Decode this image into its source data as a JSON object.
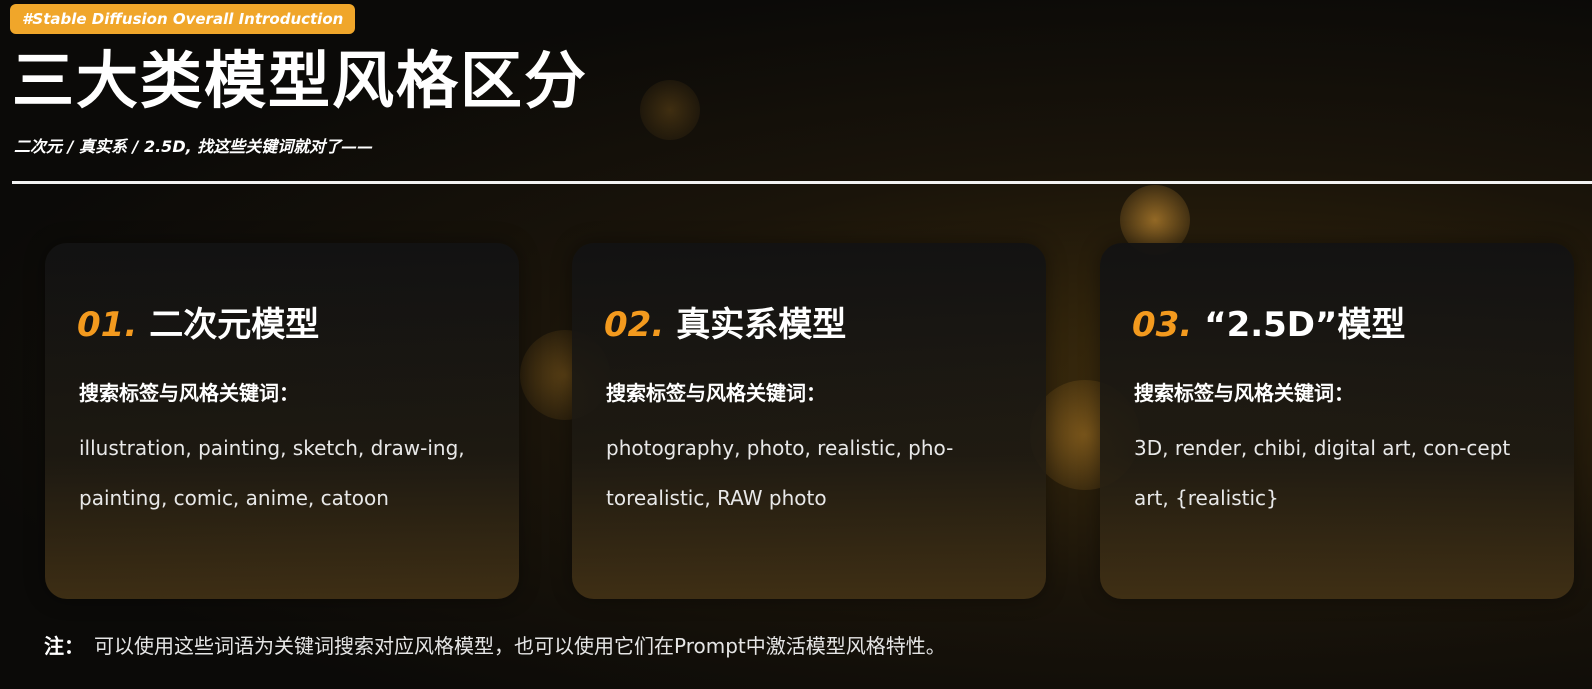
{
  "header": {
    "tag": "#Stable Diffusion Overall Introduction",
    "title": "三大类模型风格区分",
    "subtitle": "二次元 / 真实系 / 2.5D, 找这些关键词就对了——"
  },
  "cards": [
    {
      "number": "01.",
      "title": "二次元模型",
      "label": "搜索标签与风格关键词：",
      "text": "illustration, painting, sketch, draw-ing, painting, comic, anime, catoon"
    },
    {
      "number": "02.",
      "title": "真实系模型",
      "label": "搜索标签与风格关键词：",
      "text": "photography, photo, realistic, pho-torealistic, RAW photo"
    },
    {
      "number": "03.",
      "title": "“2.5D”模型",
      "label": "搜索标签与风格关键词：",
      "text": "3D, render, chibi, digital art, con-cept art, {realistic}"
    }
  ],
  "note": {
    "mark": "注：",
    "text": "可以使用这些词语为关键词搜索对应风格模型，也可以使用它们在Prompt中激活模型风格特性。"
  },
  "colors": {
    "accent": "#f39a1e",
    "tag_bg": "#f0a62a",
    "background": "#0b0a08"
  }
}
